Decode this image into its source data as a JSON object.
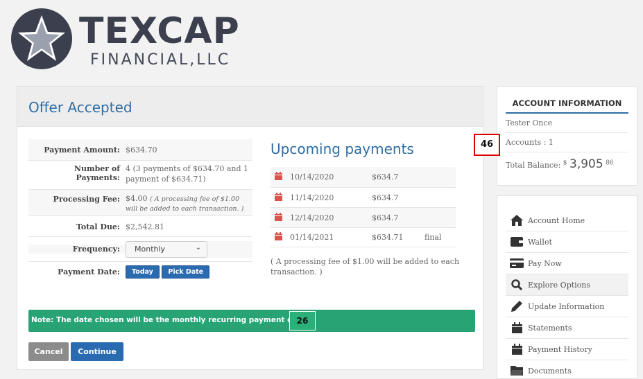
{
  "brand": {
    "name": "TEXCAP",
    "sub": "FINANCIAL,LLC"
  },
  "colors": {
    "primary": "#2a6ab1",
    "green": "#27a374",
    "title": "#2e6da4",
    "logo_circle": "#3b3f4e"
  },
  "main": {
    "title": "Offer Accepted",
    "details": {
      "amount_label": "Payment Amount:",
      "amount_value": "$634.70",
      "num_label": "Number of Payments:",
      "num_value": "4 (3 payments of $634.70 and 1 payment of $634.71)",
      "fee_label": "Processing Fee:",
      "fee_value": "$4.00",
      "fee_note": "( A processing fee of $1.00 will be added to each transaction. )",
      "total_label": "Total Due:",
      "total_value": "$2,542.81",
      "freq_label": "Frequency:",
      "freq_value": "Monthly",
      "date_label": "Payment Date:",
      "today": "Today",
      "pick": "Pick Date"
    },
    "upcoming": {
      "title": "Upcoming payments",
      "rows": [
        {
          "date": "10/14/2020",
          "amount": "$634.7",
          "note": ""
        },
        {
          "date": "11/14/2020",
          "amount": "$634.7",
          "note": ""
        },
        {
          "date": "12/14/2020",
          "amount": "$634.7",
          "note": ""
        },
        {
          "date": "01/14/2021",
          "amount": "$634.71",
          "note": "final"
        }
      ],
      "note": "( A processing fee of $1.00 will be added to each transaction. )"
    },
    "notice": "Note: The date chosen will be the monthly recurring payment date.",
    "badge_26": "26",
    "cancel": "Cancel",
    "continue": "Continue"
  },
  "account": {
    "title": "ACCOUNT INFORMATION",
    "name": "Tester Once",
    "accounts": "Accounts : 1",
    "balance_label": "Total Balance:",
    "balance_currency": "$",
    "balance_whole": "3,905",
    "balance_cents": "86",
    "badge_46": "46"
  },
  "nav": {
    "items": [
      {
        "label": "Account Home",
        "icon": "home-icon"
      },
      {
        "label": "Wallet",
        "icon": "wallet-icon"
      },
      {
        "label": "Pay Now",
        "icon": "credit-card-icon"
      },
      {
        "label": "Explore Options",
        "icon": "search-icon"
      },
      {
        "label": "Update Information",
        "icon": "pencil-icon"
      },
      {
        "label": "Statements",
        "icon": "calendar-icon"
      },
      {
        "label": "Payment History",
        "icon": "calendar-icon"
      },
      {
        "label": "Documents",
        "icon": "folder-icon"
      }
    ]
  }
}
